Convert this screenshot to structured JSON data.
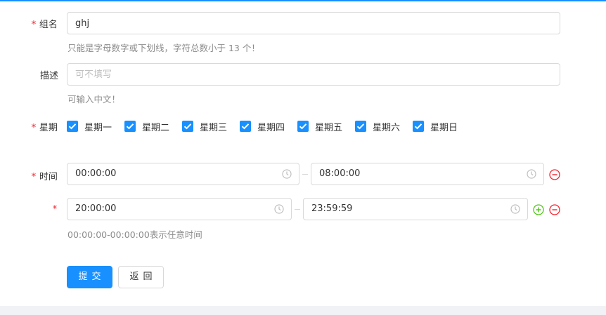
{
  "form": {
    "group_name": {
      "label": "组名",
      "required_mark": "*",
      "value": "ghj",
      "hint": "只能是字母数字或下划线，字符总数小于 13 个！"
    },
    "description": {
      "label": "描述",
      "placeholder": "可不填写",
      "hint": "可输入中文！"
    },
    "weekday": {
      "label": "星期",
      "required_mark": "*",
      "options": [
        {
          "label": "星期一",
          "checked": true
        },
        {
          "label": "星期二",
          "checked": true
        },
        {
          "label": "星期三",
          "checked": true
        },
        {
          "label": "星期四",
          "checked": true
        },
        {
          "label": "星期五",
          "checked": true
        },
        {
          "label": "星期六",
          "checked": true
        },
        {
          "label": "星期日",
          "checked": true
        }
      ]
    },
    "time": {
      "label": "时间",
      "required_mark": "*",
      "ranges": [
        {
          "start": "00:00:00",
          "end": "08:00:00"
        },
        {
          "start": "20:00:00",
          "end": "23:59:59"
        }
      ],
      "hint": "00:00:00-00:00:00表示任意时间"
    },
    "buttons": {
      "submit": "提交",
      "back": "返回"
    }
  },
  "colors": {
    "primary": "#1890ff",
    "required": "#f5222d",
    "add": "#52c41a",
    "remove": "#f5222d"
  }
}
